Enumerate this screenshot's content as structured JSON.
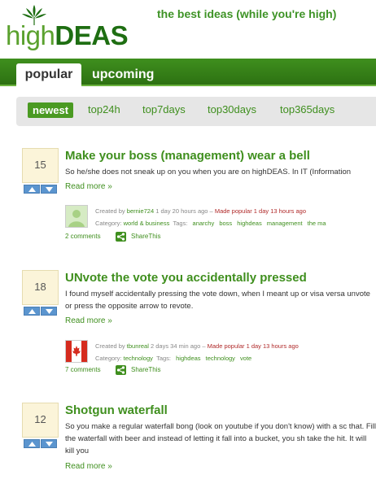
{
  "header": {
    "logo_part1": "high",
    "logo_part2": "DEAS",
    "tagline": "the best ideas (while you're high)"
  },
  "tabs": [
    {
      "label": "popular",
      "active": true
    },
    {
      "label": "upcoming",
      "active": false
    }
  ],
  "filters": [
    {
      "label": "newest",
      "active": true
    },
    {
      "label": "top24h",
      "active": false
    },
    {
      "label": "top7days",
      "active": false
    },
    {
      "label": "top30days",
      "active": false
    },
    {
      "label": "top365days",
      "active": false
    }
  ],
  "posts": [
    {
      "votes": "15",
      "title": "Make your boss (management) wear a bell",
      "excerpt": "So he/she does not sneak up on you when you are on highDEAS. In IT (Information",
      "read_more": "Read more »",
      "created_prefix": "Created by",
      "author": "bernie724",
      "age": "1 day 20 hours ago –",
      "made_popular": "Made popular 1 day 13 hours ago",
      "category_label": "Category:",
      "category": "world & business",
      "tags_label": "Tags:",
      "tags": [
        "anarchy",
        "boss",
        "highdeas",
        "management",
        "the ma"
      ],
      "comments": "2 comments",
      "share": "ShareThis",
      "avatar": "default-avatar"
    },
    {
      "votes": "18",
      "title": "UNvote the vote you accidentally pressed",
      "excerpt": "I found myself accidentally pressing the vote down, when I meant up or visa versa unvote or press the opposite arrow to revote.",
      "read_more": "Read more »",
      "created_prefix": "Created by",
      "author": "tbunreal",
      "age": "2 days 34 min ago –",
      "made_popular": "Made popular 1 day 13 hours ago",
      "category_label": "Category:",
      "category": "technology",
      "tags_label": "Tags:",
      "tags": [
        "highdeas",
        "technology",
        "vote"
      ],
      "comments": "7 comments",
      "share": "ShareThis",
      "avatar": "canada-flag"
    },
    {
      "votes": "12",
      "title": "Shotgun waterfall",
      "excerpt": "So you make a regular waterfall bong (look on youtube if you don't know) with a sc that. Fill the waterfall with beer and instead of letting it fall into a bucket, you sh take the hit. It will kill you",
      "read_more": "Read more »"
    }
  ],
  "colors": {
    "brand_green": "#3f8f1e",
    "dark_green": "#1e6e12",
    "popular_red": "#b02a2a",
    "vote_arrow_blue": "#5b95cf",
    "vote_box_bg": "#fbf4d9"
  }
}
